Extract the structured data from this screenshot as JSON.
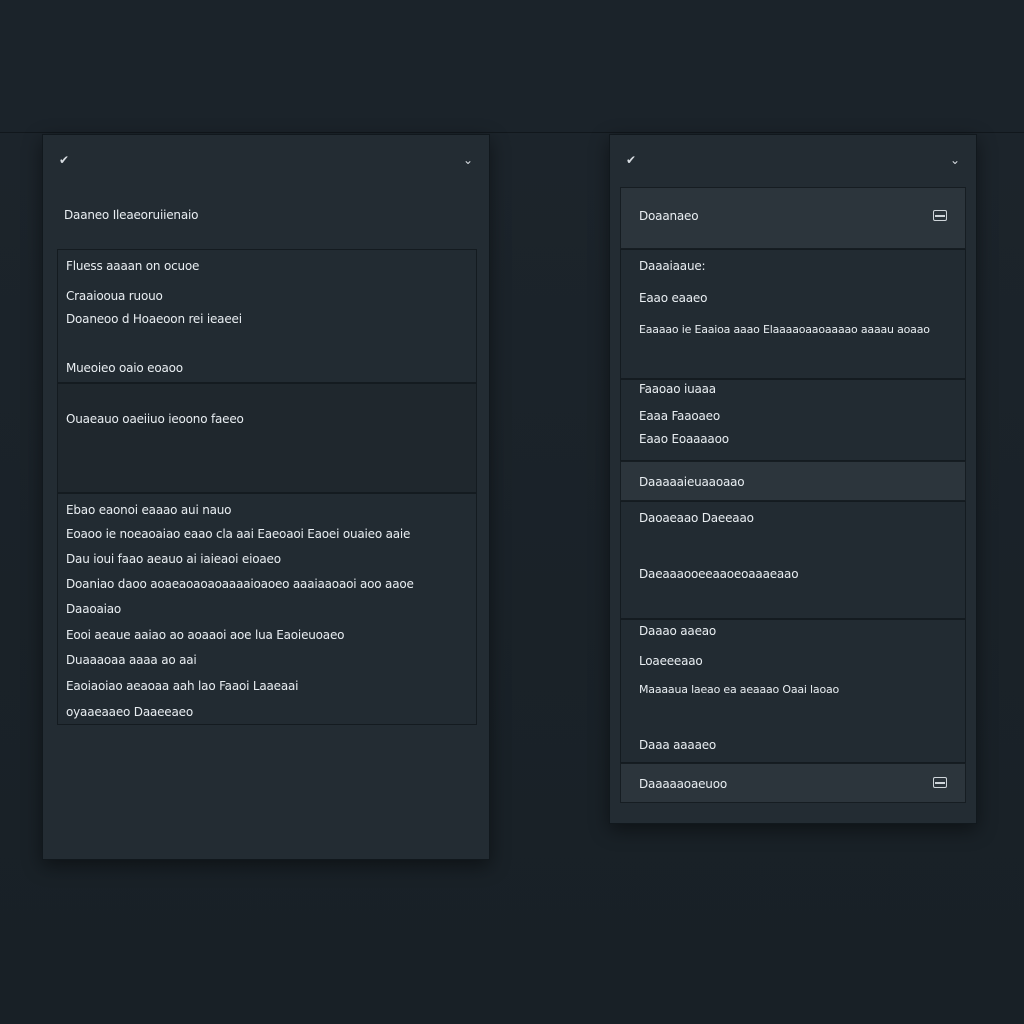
{
  "left_panel": {
    "title": "Daaneo Ileaeoruiienaio",
    "section1": {
      "heading": "Fluess aaaan on ocuoe",
      "lines": [
        "Craaiooua ruouo",
        "Doaneoo d Hoaeoon rei ieaeei",
        "Mueoieo oaio eoaoo"
      ]
    },
    "section2": {
      "line": "Ouaeauo oaeiiuo ieoono faeeo"
    },
    "section3": {
      "heading": "Ebao eaonoi eaaao aui nauo",
      "lines": [
        "Eoaoo ie noeaoaiao eaao cla aai Eaeoaoi Eaoei ouaieo aaie",
        "Dau ioui faao aeauo ai iaieaoi eioaeo",
        "Doaniao daoo aoaeaoaoaoaaaaioaoeo aaaiaaoaoi aoo aaoe",
        "Daaoaiao",
        "Eooi aeaue aaiao ao aoaaoi aoe lua Eaoieuoaeo",
        "Duaaaoaa aaaa ao aai",
        "Eaoiaoiao aeaoaa aah lao Faaoi Laaeaai",
        "oyaaeaaeo Daaeeaeo"
      ]
    }
  },
  "right_panel": {
    "header_top": {
      "title": "Doaanaeo"
    },
    "section1": {
      "lines": [
        "Daaaiaaue:",
        "Eaao eaaeo",
        "Eaaaao ie Eaaioa aaao Elaaaaoaaoaaaao aaaau aoaao"
      ]
    },
    "section2": {
      "lines": [
        "Faaoao iuaaa",
        "Eaaa Faaoaeo",
        "Eaao Eoaaaaoo"
      ]
    },
    "header_mid": {
      "title": "Daaaaaieuaaoaao"
    },
    "section3": {
      "lines": [
        "Daoaeaao Daeeaao",
        "Daeaaaooeeaaoeoaaaeaao"
      ]
    },
    "section4": {
      "lines": [
        "Daaao aaeao",
        "Loaeeeaao",
        "Maaaaua laeao ea aeaaao Oaai laoao",
        "Daaa aaaaeo"
      ]
    },
    "header_bottom": {
      "title": "Daaaaaoaeuoo"
    }
  },
  "icons": {
    "corner_left": "chevron-check-icon",
    "corner_right": "chevron-down-icon",
    "row_icon": "card-icon"
  }
}
